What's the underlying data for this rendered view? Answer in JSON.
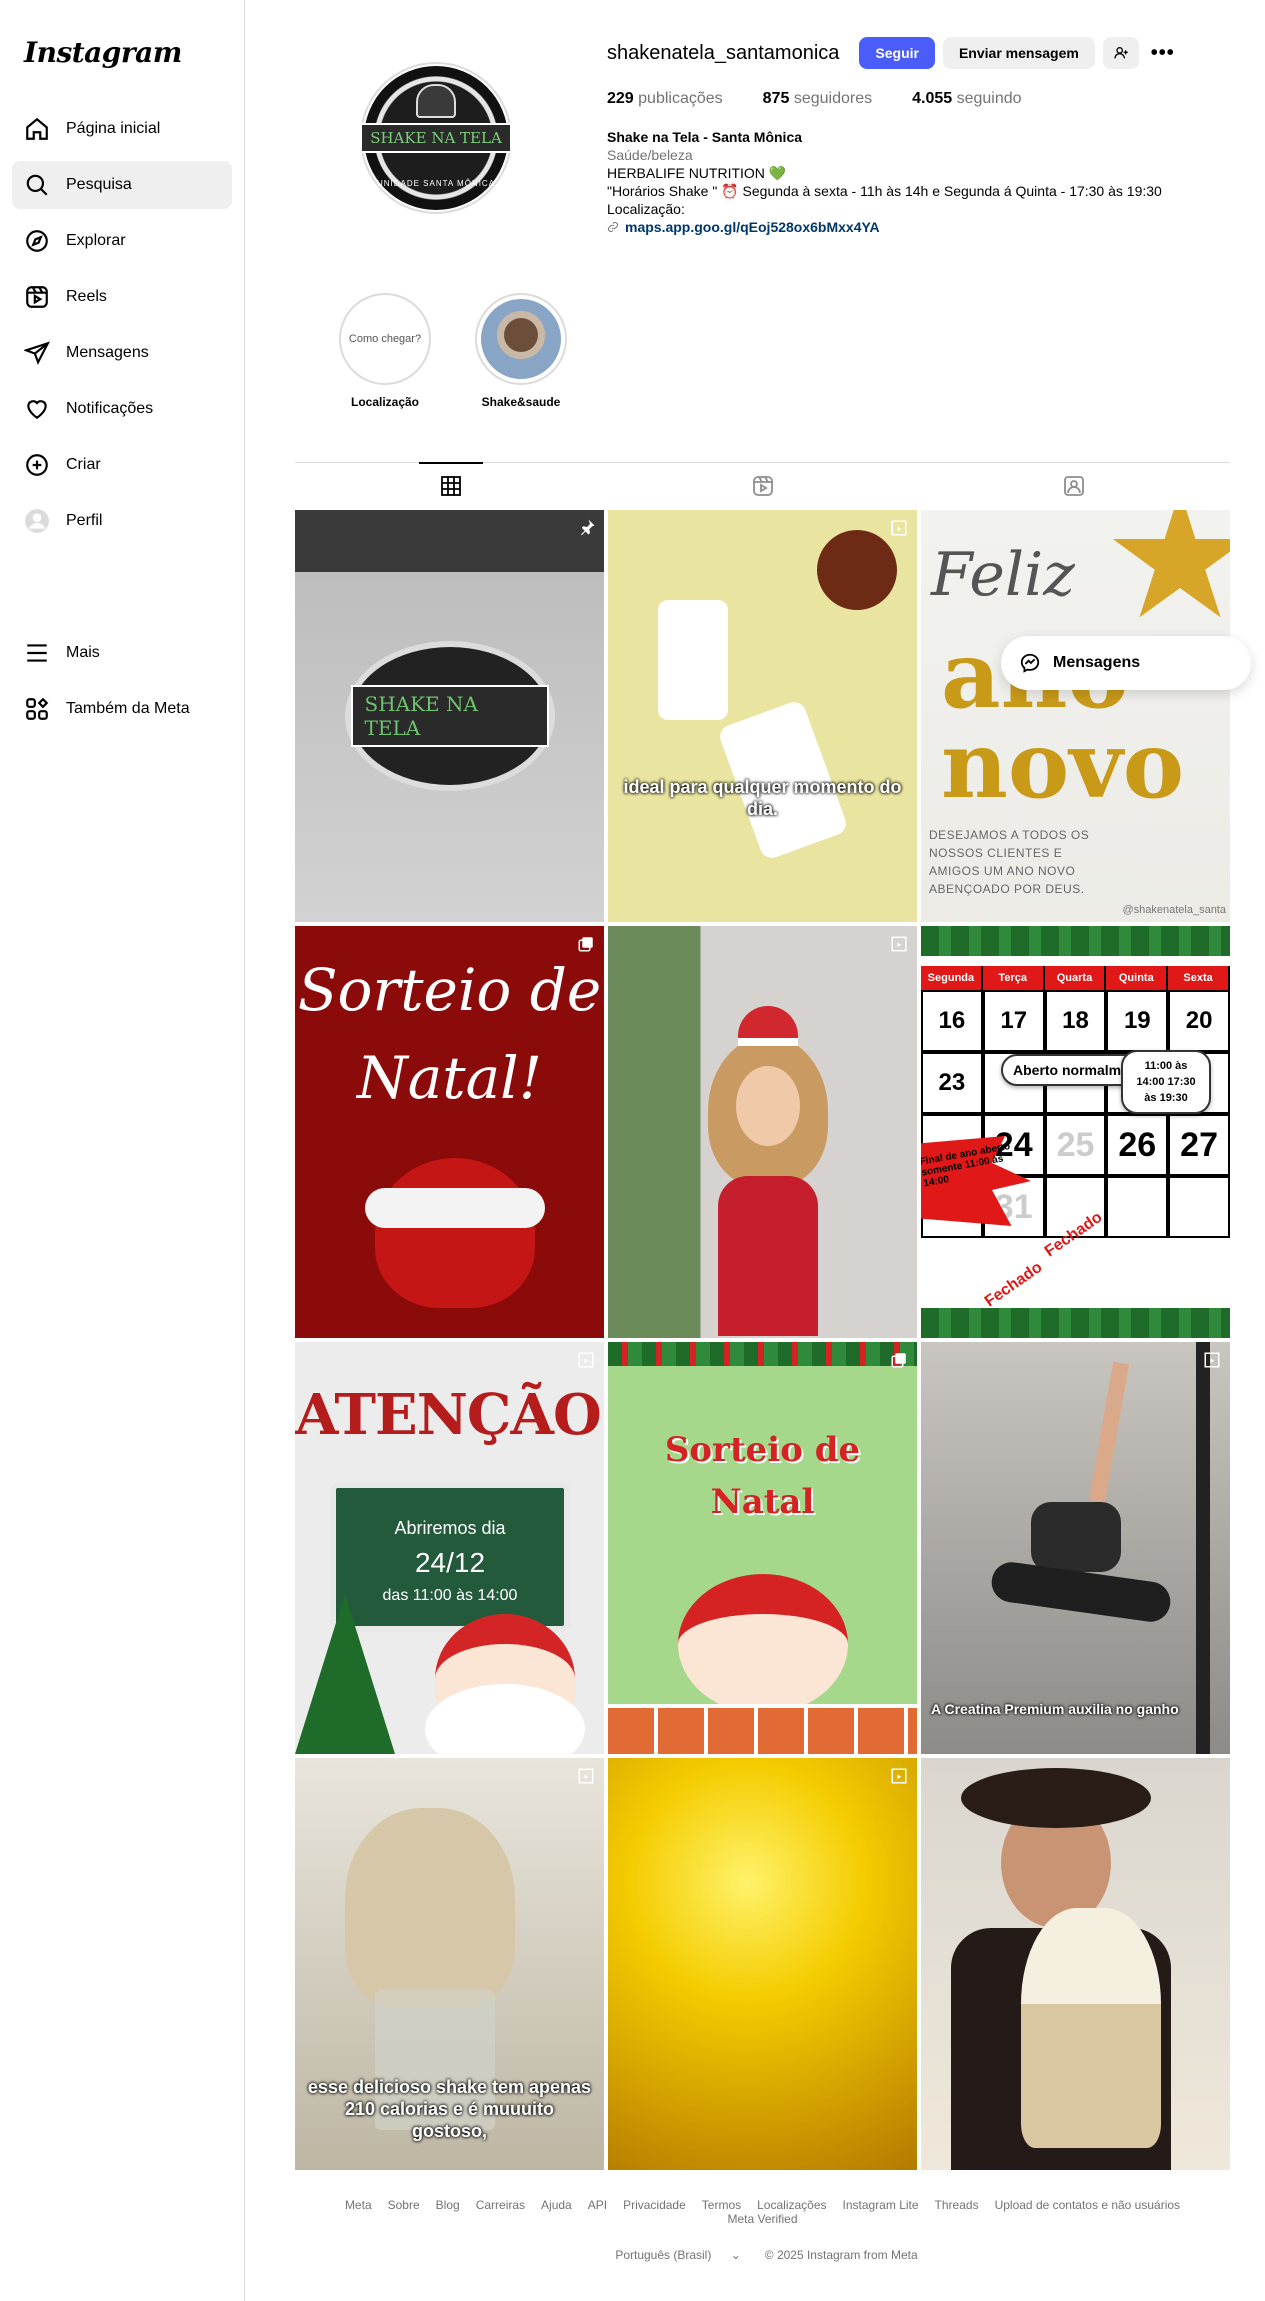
{
  "sidebar": {
    "logo": "Instagram",
    "items": [
      {
        "label": "Página inicial",
        "icon": "home-icon"
      },
      {
        "label": "Pesquisa",
        "icon": "search-icon"
      },
      {
        "label": "Explorar",
        "icon": "compass-icon"
      },
      {
        "label": "Reels",
        "icon": "reels-icon"
      },
      {
        "label": "Mensagens",
        "icon": "send-icon"
      },
      {
        "label": "Notificações",
        "icon": "heart-icon"
      },
      {
        "label": "Criar",
        "icon": "plus-square-icon"
      },
      {
        "label": "Perfil",
        "icon": "avatar-icon"
      }
    ],
    "bottom_items": [
      {
        "label": "Mais",
        "icon": "menu-icon"
      },
      {
        "label": "Também da Meta",
        "icon": "meta-apps-icon"
      }
    ]
  },
  "profile": {
    "username": "shakenatela_santamonica",
    "follow_label": "Seguir",
    "message_label": "Enviar mensagem",
    "avatar_text": "SHAKE NA TELA",
    "avatar_sub": "UNIDADE SANTA MÔNICA",
    "stats": {
      "posts_count": "229",
      "posts_label": "publicações",
      "followers_count": "875",
      "followers_label": "seguidores",
      "following_count": "4.055",
      "following_label": "seguindo"
    },
    "bio": {
      "name": "Shake na Tela - Santa Mônica",
      "category": "Saúde/beleza",
      "line1": "HERBALIFE NUTRITION",
      "line1_emoji": "💚",
      "line2_prefix": "\"Horários Shake \"",
      "line2_emoji": "⏰",
      "line2_text": "Segunda à sexta - 11h às 14h e Segunda á Quinta - 17:30 às 19:30",
      "line3": "Localização:",
      "link": "maps.app.goo.gl/qEoj528ox6bMxx4YA"
    }
  },
  "highlights": [
    {
      "label": "Localização",
      "inner_text": "Como chegar?"
    },
    {
      "label": "Shake&saude",
      "inner_text": ""
    }
  ],
  "posts": {
    "p1": {
      "logo": "SHAKE NA TELA"
    },
    "p2": {
      "caption": "ideal para qualquer momento do dia."
    },
    "p3": {
      "feliz": "Feliz",
      "ano": "ano",
      "novo": "novo",
      "wish": "DESEJAMOS A TODOS OS NOSSOS CLIENTES E AMIGOS UM ANO NOVO ABENÇOADO POR DEUS.",
      "handle": "@shakenatela_santa"
    },
    "p4": {
      "title1": "Sorteio de",
      "title2": "Natal!"
    },
    "p6": {
      "days": [
        "Segunda",
        "Terça",
        "Quarta",
        "Quinta",
        "Sexta"
      ],
      "row1": [
        "16",
        "17",
        "18",
        "19",
        "20"
      ],
      "row2": [
        "23"
      ],
      "row3": [
        "24",
        "25",
        "26",
        "27"
      ],
      "row4": [
        "30",
        "31"
      ],
      "bubble1": "Aberto normalmente",
      "bubble2": "11:00 às 14:00 17:30 às 19:30",
      "burst": "Final de ano aberto somente 11:00 às 14:00",
      "fechado": "Fechado"
    },
    "p7": {
      "title": "ATENÇÃO!",
      "line1": "Abriremos dia",
      "line2": "24/12",
      "line3": "das 11:00 às 14:00"
    },
    "p8": {
      "title1": "Sorteio de",
      "title2": "Natal"
    },
    "p9": {
      "caption": "A Creatina Premium auxilia no ganho"
    },
    "p10": {
      "caption": "esse delicioso shake tem apenas 210 calorias e é muuuito gostoso,"
    }
  },
  "floating_messages": "Mensagens",
  "footer": {
    "links": [
      "Meta",
      "Sobre",
      "Blog",
      "Carreiras",
      "Ajuda",
      "API",
      "Privacidade",
      "Termos",
      "Localizações",
      "Instagram Lite",
      "Threads",
      "Upload de contatos e não usuários",
      "Meta Verified"
    ],
    "language": "Português (Brasil)",
    "copyright": "© 2025 Instagram from Meta"
  }
}
